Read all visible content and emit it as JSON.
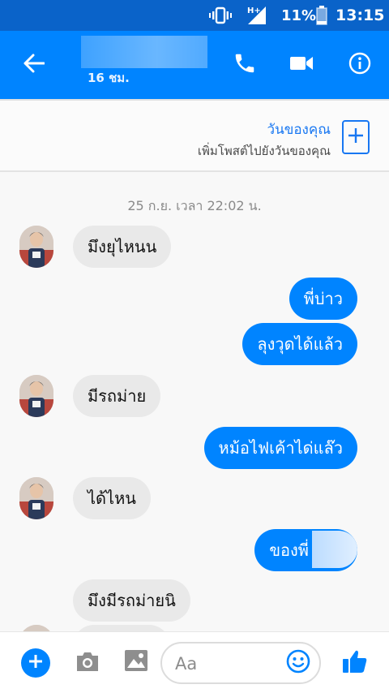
{
  "status_bar": {
    "battery_text": "11%",
    "time": "13:15",
    "network": "H+"
  },
  "header": {
    "last_seen": "16 ชม.",
    "icons": [
      "back-arrow-icon",
      "phone-icon",
      "video-camera-icon",
      "info-icon"
    ]
  },
  "your_day": {
    "title": "วันของคุณ",
    "subtitle": "เพิ่มโพสต์ไปยังวันของคุณ"
  },
  "chat": {
    "timestamp": "25 ก.ย. เวลา 22:02 น.",
    "messages": [
      {
        "from": "them",
        "text": "มึงยุไหนน"
      },
      {
        "from": "me",
        "text": "พี่บ่าว"
      },
      {
        "from": "me",
        "text": "ลุงวุดได้แล้ว"
      },
      {
        "from": "them",
        "text": "มีรถม่าย"
      },
      {
        "from": "me",
        "text": "หม้อไฟเค้าได่แล๊ว"
      },
      {
        "from": "them",
        "text": "ได้ไหน"
      },
      {
        "from": "me",
        "text": "ของพี่"
      },
      {
        "from": "them",
        "text": "มึงมีรถม่ายนิ"
      }
    ]
  },
  "composer": {
    "placeholder": "Aa",
    "colors": {
      "accent": "#0084ff",
      "icon_gray": "#8e8e8e"
    }
  },
  "colors": {
    "statusbar": "#0a63c9",
    "appbar": "#0084ff",
    "outgoing_bubble": "#0084ff",
    "incoming_bubble": "#e9e9e9"
  }
}
